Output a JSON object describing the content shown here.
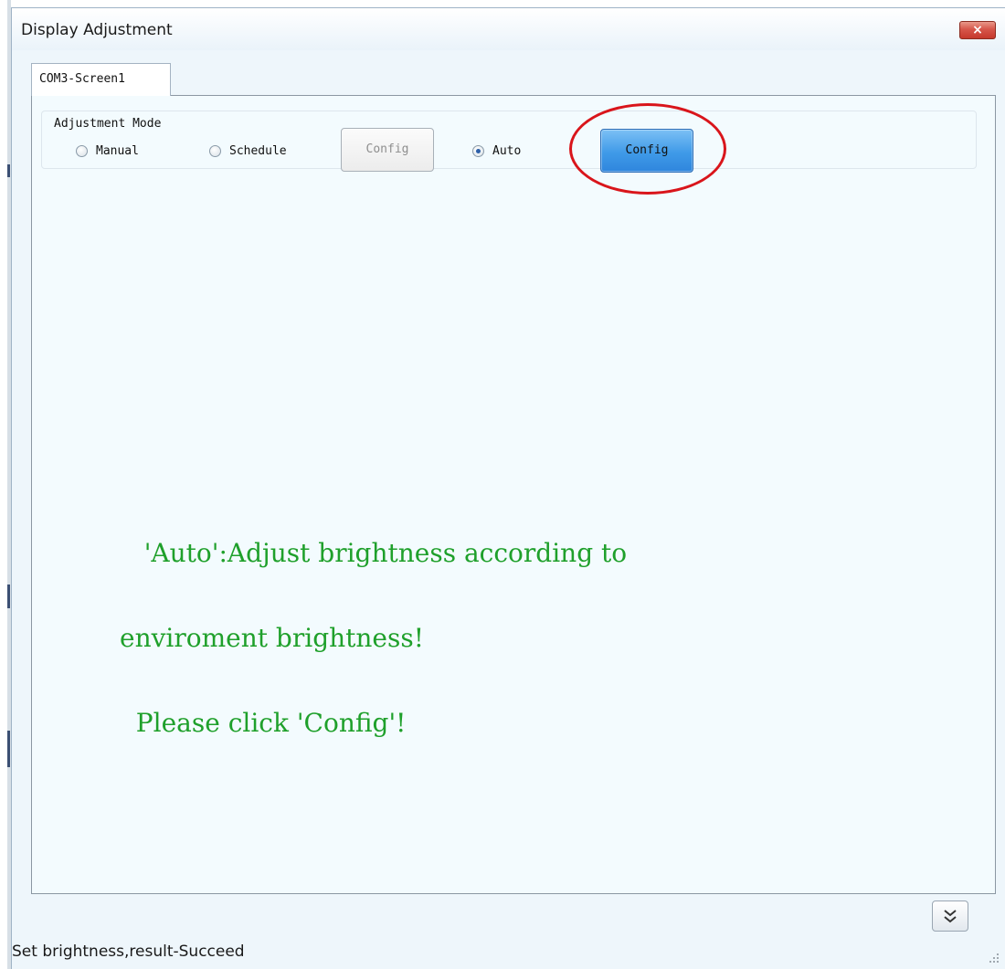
{
  "window": {
    "title": "Display Adjustment",
    "close_label": "×"
  },
  "tabs": [
    {
      "label": "COM3-Screen1",
      "selected": true
    }
  ],
  "adjustment_mode": {
    "group_title": "Adjustment Mode",
    "options": [
      {
        "label": "Manual",
        "checked": false
      },
      {
        "label": "Schedule",
        "checked": false
      },
      {
        "label": "Auto",
        "checked": true
      }
    ],
    "schedule_config_label": "Config",
    "auto_config_label": "Config"
  },
  "hint_lines": [
    "   'Auto':Adjust brightness according to",
    "enviroment brightness!",
    "  Please click 'Config'!"
  ],
  "status_bar": {
    "text": "Set brightness,result-Succeed"
  },
  "colors": {
    "hint_text": "#1fa02b",
    "annotation_circle": "#d9151b",
    "active_button": "#3f9ae8",
    "close_button": "#c6392c"
  },
  "icons": {
    "close": "close-icon",
    "expand": "double-chevron-down-icon",
    "resize": "resize-grip-icon"
  }
}
